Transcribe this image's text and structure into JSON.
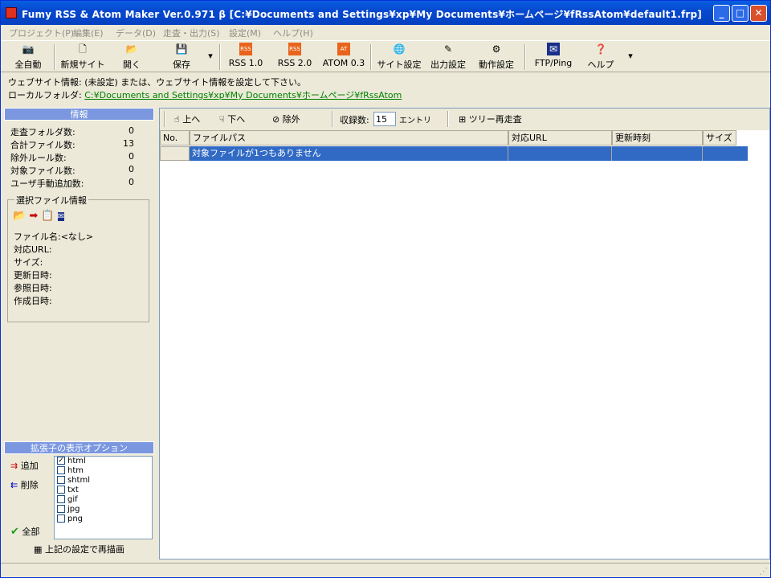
{
  "window": {
    "title": "Fumy RSS & Atom Maker  Ver.0.971 β  [C:¥Documents and Settings¥xp¥My Documents¥ホームページ¥fRssAtom¥default1.frp]"
  },
  "window_controls": {
    "minimize": "_",
    "maximize": "□",
    "close": "✕"
  },
  "menu": [
    "プロジェクト(P)",
    "編集(E)",
    "データ(D)",
    "走査・出力(S)",
    "設定(M)",
    "ヘルプ(H)"
  ],
  "toolbar": [
    {
      "label": "全自動",
      "icon": "camera-icon"
    },
    {
      "label": "新規サイト",
      "icon": "new-page-icon"
    },
    {
      "label": "開く",
      "icon": "open-folder-icon"
    },
    {
      "label": "保存",
      "icon": "save-icon"
    },
    {
      "label": "RSS 1.0",
      "icon": "rss1-icon"
    },
    {
      "label": "RSS 2.0",
      "icon": "rss2-icon"
    },
    {
      "label": "ATOM 0.3",
      "icon": "atom-icon"
    },
    {
      "label": "サイト設定",
      "icon": "globe-icon"
    },
    {
      "label": "出力設定",
      "icon": "output-icon"
    },
    {
      "label": "動作設定",
      "icon": "run-settings-icon"
    },
    {
      "label": "FTP/Ping",
      "icon": "ftp-icon"
    },
    {
      "label": "ヘルプ",
      "icon": "help-icon"
    }
  ],
  "info": {
    "website_label": "ウェブサイト情報:",
    "website_value": "(未設定) または、ウェブサイト情報を設定して下さい。",
    "local_label": "ローカルフォルダ:",
    "local_path": "C:¥Documents and Settings¥xp¥My Documents¥ホームページ¥fRssAtom"
  },
  "stats": {
    "header": "情報",
    "rows": [
      {
        "label": "走査フォルダ数:",
        "value": "0"
      },
      {
        "label": "合計ファイル数:",
        "value": "13"
      },
      {
        "label": "除外ルール数:",
        "value": "0"
      },
      {
        "label": "対象ファイル数:",
        "value": "0"
      },
      {
        "label": "ユーザ手動追加数:",
        "value": "0"
      }
    ]
  },
  "selected": {
    "title": "選択ファイル情報",
    "lines": [
      "ファイル名:<なし>",
      "対応URL:",
      "サイズ:",
      "更新日時:",
      "参照日時:",
      "作成日時:"
    ]
  },
  "ext": {
    "header": "拡張子の表示オプション",
    "add": "追加",
    "remove": "削除",
    "all": "全部",
    "redraw": "上記の設定で再描画",
    "items": [
      {
        "name": "html",
        "checked": true
      },
      {
        "name": "htm",
        "checked": false
      },
      {
        "name": "shtml",
        "checked": false
      },
      {
        "name": "txt",
        "checked": false
      },
      {
        "name": "gif",
        "checked": false
      },
      {
        "name": "jpg",
        "checked": false
      },
      {
        "name": "png",
        "checked": false
      }
    ]
  },
  "list_toolbar": {
    "up": "上へ",
    "down": "下へ",
    "exclude": "除外",
    "count_label": "収録数:",
    "count_value": "15",
    "count_unit": "エントリ",
    "rescan": "ツリー再走査"
  },
  "grid": {
    "columns": [
      "No.",
      "ファイルパス",
      "対応URL",
      "更新時刻",
      "サイズ"
    ],
    "empty_message": "対象ファイルが1つもありません"
  },
  "colors": {
    "selection": "#316ac5",
    "title_bar": "#0a5fe0",
    "link": "#008000",
    "pane_header": "#7b97e0"
  }
}
